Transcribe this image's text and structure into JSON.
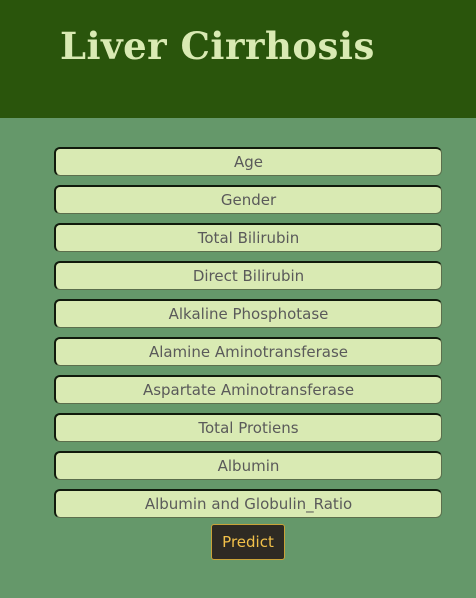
{
  "header": {
    "title": "Liver Cirrhosis"
  },
  "form": {
    "fields": [
      {
        "placeholder": "Age",
        "value": ""
      },
      {
        "placeholder": "Gender",
        "value": ""
      },
      {
        "placeholder": "Total Bilirubin",
        "value": ""
      },
      {
        "placeholder": "Direct Bilirubin",
        "value": ""
      },
      {
        "placeholder": "Alkaline Phosphotase",
        "value": ""
      },
      {
        "placeholder": "Alamine Aminotransferase",
        "value": ""
      },
      {
        "placeholder": "Aspartate Aminotransferase",
        "value": ""
      },
      {
        "placeholder": "Total Protiens",
        "value": ""
      },
      {
        "placeholder": "Albumin",
        "value": ""
      },
      {
        "placeholder": "Albumin and Globulin_Ratio",
        "value": ""
      }
    ],
    "submit_label": "Predict"
  },
  "colors": {
    "header_background": "#2a550c",
    "page_background": "#65986a",
    "title_text": "#d9eab3",
    "field_background": "#d9eab3",
    "button_background": "#2e2a23",
    "button_text": "#f2c14a",
    "button_border": "#c9a238"
  }
}
